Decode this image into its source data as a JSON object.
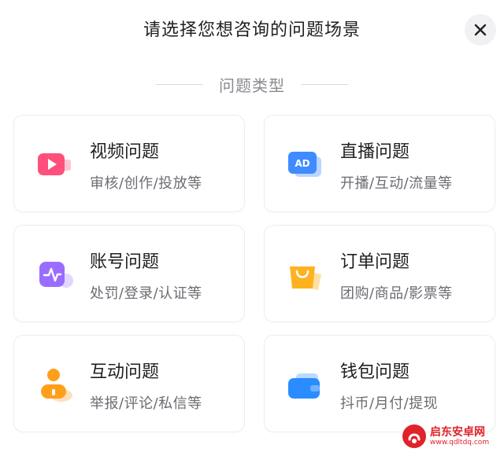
{
  "dialog": {
    "title": "请选择您想咨询的问题场景",
    "close_label": "×"
  },
  "section": {
    "heading": "问题类型"
  },
  "cards": [
    {
      "title": "视频问题",
      "desc": "审核/创作/投放等",
      "icon": "video-icon",
      "color": "#ff4f7b"
    },
    {
      "title": "直播问题",
      "desc": "开播/互动/流量等",
      "icon": "ad-icon",
      "color": "#3f8bff"
    },
    {
      "title": "账号问题",
      "desc": "处罚/登录/认证等",
      "icon": "account-icon",
      "color": "#9a6cff"
    },
    {
      "title": "订单问题",
      "desc": "团购/商品/影票等",
      "icon": "shopping-bag-icon",
      "color": "#ffb21f"
    },
    {
      "title": "互动问题",
      "desc": "举报/评论/私信等",
      "icon": "user-icon",
      "color": "#ff9f1a"
    },
    {
      "title": "钱包问题",
      "desc": "抖币/月付/提现",
      "icon": "wallet-icon",
      "color": "#2a8cff"
    }
  ],
  "watermark": {
    "main": "启东安卓网",
    "url": "www.qdltdq.com"
  }
}
